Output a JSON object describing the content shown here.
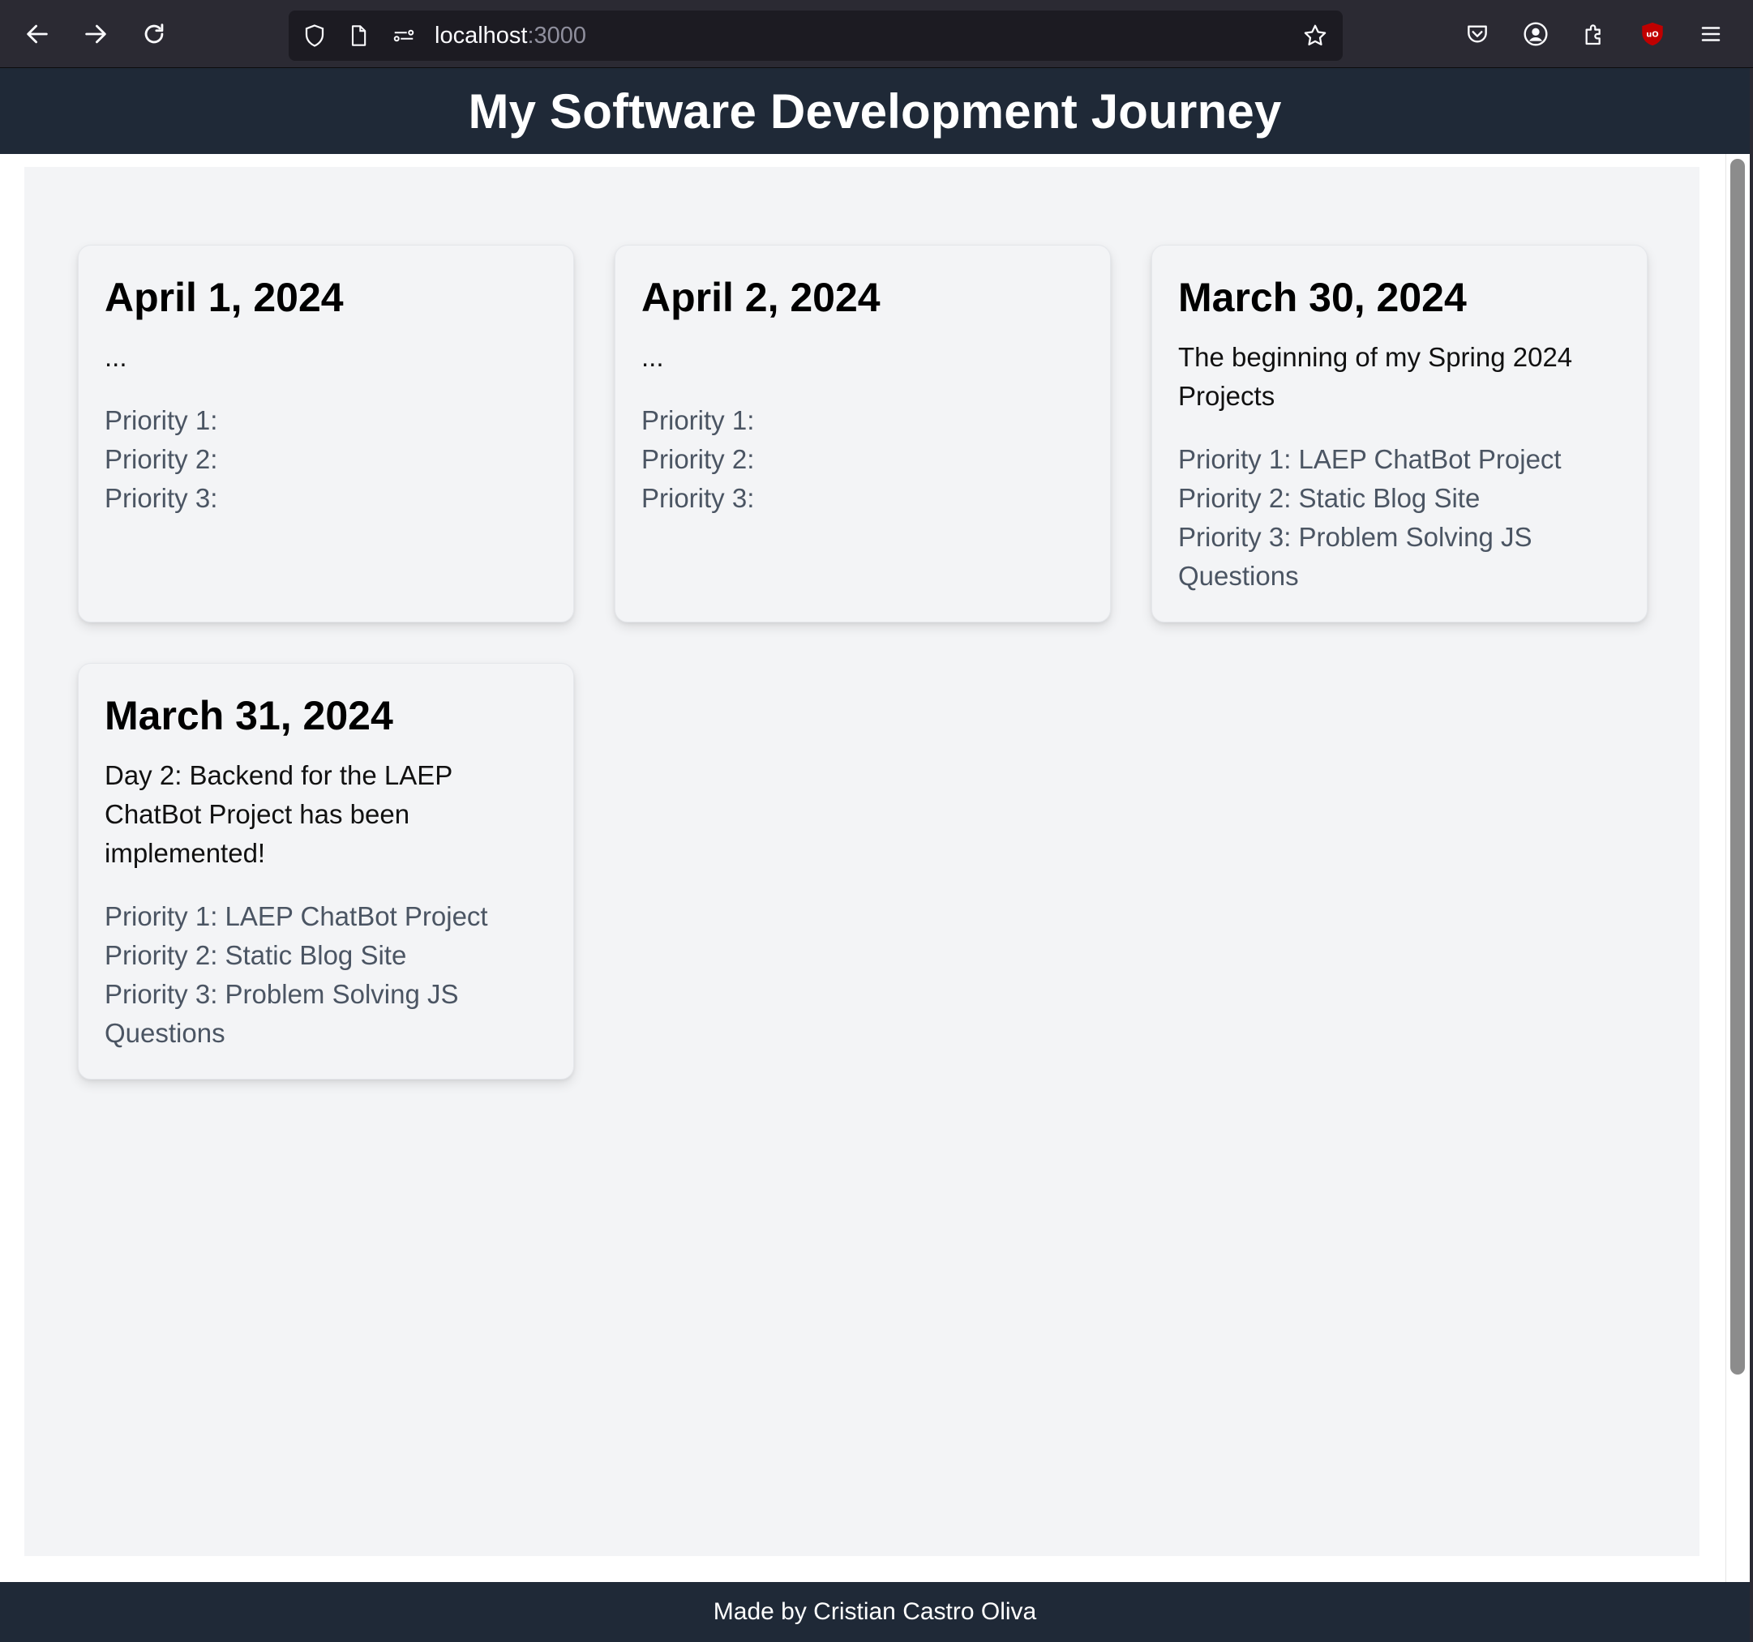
{
  "browser": {
    "url_host": "localhost",
    "url_port": ":3000",
    "icons": {
      "back": "back-arrow-icon",
      "forward": "forward-arrow-icon",
      "reload": "reload-icon",
      "shield": "shield-icon",
      "page": "page-icon",
      "permissions": "permissions-icon",
      "bookmark": "star-icon",
      "pocket": "pocket-icon",
      "account": "account-icon",
      "extensions": "puzzle-icon",
      "ublock": "ublock-icon",
      "menu": "hamburger-menu-icon"
    }
  },
  "header": {
    "title": "My Software Development Journey"
  },
  "cards": [
    {
      "date": "April 1, 2024",
      "description": "...",
      "priorities": [
        "Priority 1:",
        "Priority 2:",
        "Priority 3:"
      ]
    },
    {
      "date": "April 2, 2024",
      "description": "...",
      "priorities": [
        "Priority 1:",
        "Priority 2:",
        "Priority 3:"
      ]
    },
    {
      "date": "March 30, 2024",
      "description": "The beginning of my Spring 2024 Projects",
      "priorities": [
        "Priority 1: LAEP ChatBot Project",
        "Priority 2: Static Blog Site",
        "Priority 3: Problem Solving JS Questions"
      ]
    },
    {
      "date": "March 31, 2024",
      "description": "Day 2: Backend for the LAEP ChatBot Project has been implemented!",
      "priorities": [
        "Priority 1: LAEP ChatBot Project",
        "Priority 2: Static Blog Site",
        "Priority 3: Problem Solving JS Questions"
      ]
    }
  ],
  "footer": {
    "text": "Made by Cristian Castro Oliva"
  },
  "colors": {
    "header_bg": "#1f2937",
    "content_bg": "#f3f4f6",
    "priority_text": "#4b5563",
    "chrome_bg": "#2b2a33",
    "ublock_red": "#c00000"
  }
}
